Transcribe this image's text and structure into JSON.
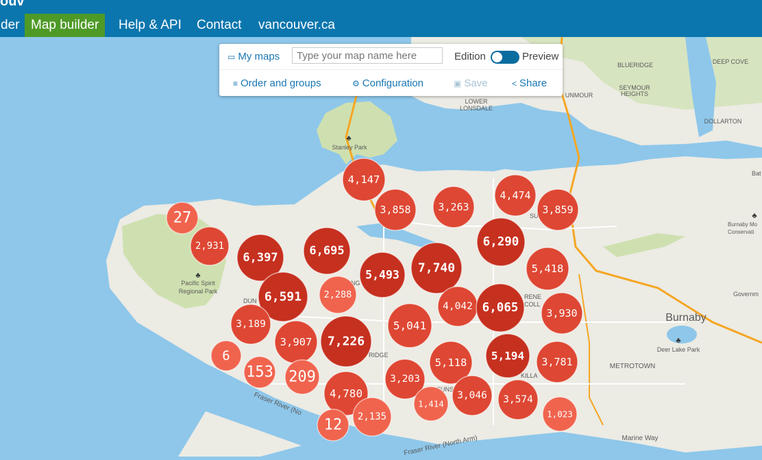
{
  "header": {
    "brand_fragment": "ouv",
    "nav": [
      {
        "label": "der",
        "active": false
      },
      {
        "label": "Map builder",
        "active": true
      },
      {
        "label": "Help & API",
        "active": false
      },
      {
        "label": "Contact",
        "active": false
      },
      {
        "label": "vancouver.ca",
        "active": false
      }
    ]
  },
  "panel": {
    "my_maps": "My maps",
    "map_name_placeholder": "Type your map name here",
    "edition": "Edition",
    "preview": "Preview",
    "order_and_groups": "Order and groups",
    "configuration": "Configuration",
    "save": "Save",
    "share": "Share",
    "icons": [
      "map-icon",
      "list-icon",
      "gear-icon",
      "floppy-icon",
      "share-icon"
    ]
  },
  "map_labels": {
    "stanley_park": "Stanley Park",
    "pacific_spirit_1": "Pacific Spirit",
    "pacific_spirit_2": "Regional Park",
    "burnaby": "Burnaby",
    "deer_lake_park": "Deer Lake Park",
    "metrotown": "METROTOWN",
    "blueridge": "BLUERIDGE",
    "deep_cove": "DEEP COVE",
    "seymour_1": "SEYMOUR",
    "seymour_2": "HEIGHTS",
    "lower_lonsdale_1": "LOWER",
    "lower_lonsdale_2": "LONSDALE",
    "dollarton": "DOLLARTON",
    "dunmour": "UNMOUR",
    "governm": "Governm",
    "burnaby_mtn_1": "Burnaby Mo",
    "burnaby_mtn_2": "Conservati",
    "marine_way": "Marine Way",
    "fraser_river_1": "Fraser River (No",
    "fraser_river_2": "Fraser River (North Arm)",
    "bat": "Bat",
    "dun": "DUN",
    "ridge_1": "RIDGE",
    "rene_1": "RENE",
    "coll_1": "COLL",
    "killa": "KILLA",
    "suns": "SUNS",
    "su": "SU",
    "ng": "NG"
  },
  "colors": {
    "header": "#0b76ad",
    "active_nav": "#4e9a27",
    "water": "#8ec7ea",
    "land": "#ecebe4",
    "park": "#cfe0b0",
    "cluster_small": "#f0644e",
    "cluster_mid": "#de4733",
    "cluster_big": "#c6301f"
  },
  "clusters": [
    {
      "label": "4,147",
      "level": 2
    },
    {
      "label": "27",
      "level": 1
    },
    {
      "label": "3,858",
      "level": 2
    },
    {
      "label": "3,263",
      "level": 2
    },
    {
      "label": "4,474",
      "level": 2
    },
    {
      "label": "3,859",
      "level": 2
    },
    {
      "label": "2,931",
      "level": 2
    },
    {
      "label": "6,397",
      "level": 3
    },
    {
      "label": "6,695",
      "level": 3
    },
    {
      "label": "6,290",
      "level": 3
    },
    {
      "label": "5,493",
      "level": 3
    },
    {
      "label": "7,740",
      "level": 3
    },
    {
      "label": "5,418",
      "level": 2
    },
    {
      "label": "6,591",
      "level": 3
    },
    {
      "label": "2,288",
      "level": 1
    },
    {
      "label": "4,042",
      "level": 2
    },
    {
      "label": "6,065",
      "level": 3
    },
    {
      "label": "3,930",
      "level": 2
    },
    {
      "label": "3,189",
      "level": 2
    },
    {
      "label": "5,041",
      "level": 2
    },
    {
      "label": "3,907",
      "level": 2
    },
    {
      "label": "7,226",
      "level": 3
    },
    {
      "label": "6",
      "level": 1
    },
    {
      "label": "153",
      "level": 1
    },
    {
      "label": "209",
      "level": 1
    },
    {
      "label": "5,118",
      "level": 2
    },
    {
      "label": "5,194",
      "level": 3
    },
    {
      "label": "3,781",
      "level": 2
    },
    {
      "label": "3,203",
      "level": 2
    },
    {
      "label": "4,780",
      "level": 2
    },
    {
      "label": "1,414",
      "level": 1
    },
    {
      "label": "3,046",
      "level": 2
    },
    {
      "label": "3,574",
      "level": 2
    },
    {
      "label": "12",
      "level": 1
    },
    {
      "label": "2,135",
      "level": 1
    },
    {
      "label": "1,023",
      "level": 1
    }
  ]
}
